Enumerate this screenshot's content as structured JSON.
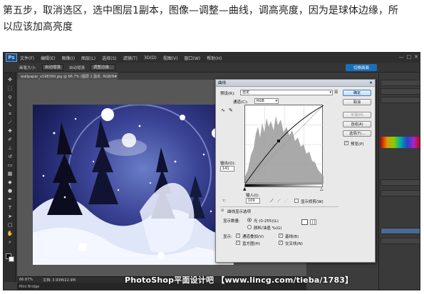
{
  "caption": {
    "line1": "第五步，取消选区，选中图层1副本，图像—调整—曲线，调高亮度，因为是球体边缘，所",
    "line2": "以应该加高亮度"
  },
  "photoshop": {
    "logo": "Ps",
    "menu": [
      "文件(F)",
      "编辑(E)",
      "图像(I)",
      "图层(L)",
      "选择(S)",
      "滤镜(T)",
      "3D(D)",
      "视图(V)",
      "窗口(W)",
      "帮助(H)"
    ],
    "window_controls": [
      "—",
      "□",
      "✕"
    ],
    "options": {
      "size_label": "画笔大小:",
      "size_value": "",
      "mode_value": "自动增强",
      "sample_label": "",
      "sample_value": "",
      "auto_label": "自动增强",
      "refine_label": "调整边缘..."
    },
    "workspace_button": "切换面面",
    "document_tab": "wallpaper_x198390.jpg @ 66.7% (图层 1 副本, RGB/8#)",
    "statusbar": {
      "zoom": "66.67%",
      "doc": "文档: 3.93M/22.9M"
    },
    "mini_bridge": "Mini Bridge",
    "watermark": "PhotoShop平面设计吧 【www.lincg.com/tieba/1783】",
    "right_panel_rows": [
      "",
      "",
      "",
      "",
      "",
      "",
      ""
    ]
  },
  "curves_dialog": {
    "title": "曲线",
    "close": "✕",
    "preset_label": "预设(R):",
    "preset_value": "自定",
    "channel_label": "通道(C):",
    "channel_value": "RGB",
    "buttons": {
      "ok": "确定",
      "cancel": "取消",
      "smooth": "平滑(M)",
      "auto": "自动(A)",
      "options": "选项(T)..."
    },
    "preview_label": "预览(P)",
    "output_label": "输出(O):",
    "output_value": "141",
    "input_label": "输入(I):",
    "input_value": "109",
    "show_clipping_label": "显示修剪(W)",
    "curve_display_label": "曲线显示选项",
    "show_amount_label": "显示数量:",
    "light_option": "光 (0-255)(L)",
    "pigment_option": "颜料/油墨 %(G)",
    "show_label": "显示:",
    "show_items": [
      "通道叠加(V)",
      "基线(B)",
      "直方图(H)",
      "交叉线(N)"
    ]
  },
  "colors": {
    "ps_dark": "#2e2e2e",
    "accent_blue": "#1b6fb6",
    "dialog_bg": "#e9e9e9"
  }
}
